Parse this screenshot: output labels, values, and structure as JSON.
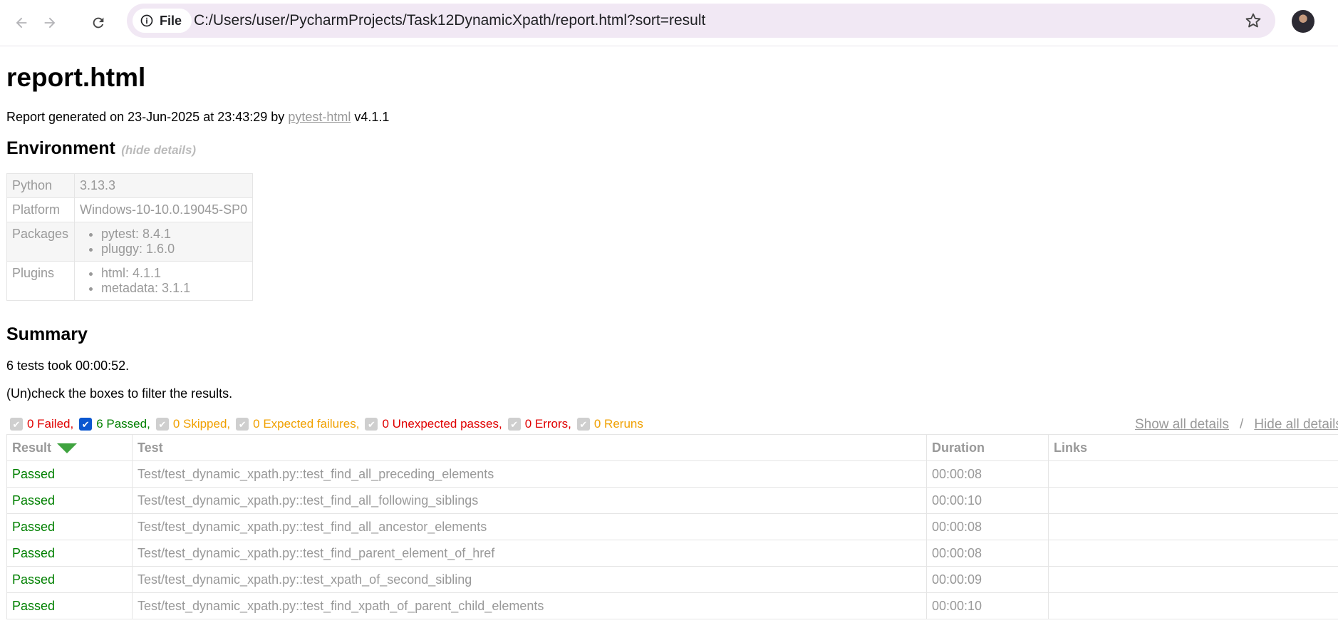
{
  "browser": {
    "site_info_label": "File",
    "url": "C:/Users/user/PycharmProjects/Task12DynamicXpath/report.html?sort=result"
  },
  "report": {
    "title": "report.html",
    "generated_prefix": "Report generated on 23-Jun-2025 at 23:43:29 by",
    "generator_link": "pytest-html",
    "generator_version": "v4.1.1"
  },
  "environment": {
    "heading": "Environment",
    "toggle": "(hide details)",
    "rows": [
      {
        "key": "Python",
        "value": "3.13.3"
      },
      {
        "key": "Platform",
        "value": "Windows-10-10.0.19045-SP0"
      },
      {
        "key": "Packages",
        "items": [
          "pytest: 8.4.1",
          "pluggy: 1.6.0"
        ]
      },
      {
        "key": "Plugins",
        "items": [
          "html: 4.1.1",
          "metadata: 3.1.1"
        ]
      }
    ]
  },
  "summary": {
    "heading": "Summary",
    "took": "6 tests took 00:00:52.",
    "filter_hint": "(Un)check the boxes to filter the results.",
    "filters": [
      {
        "label": "0 Failed,",
        "color": "#e00000",
        "checked": true,
        "disabled": true
      },
      {
        "label": "6 Passed,",
        "color": "#008000",
        "checked": true,
        "disabled": false
      },
      {
        "label": "0 Skipped,",
        "color": "#f0a000",
        "checked": true,
        "disabled": true
      },
      {
        "label": "0 Expected failures,",
        "color": "#f0a000",
        "checked": true,
        "disabled": true
      },
      {
        "label": "0 Unexpected passes,",
        "color": "#e00000",
        "checked": true,
        "disabled": true
      },
      {
        "label": "0 Errors,",
        "color": "#e00000",
        "checked": true,
        "disabled": true
      },
      {
        "label": "0 Reruns",
        "color": "#f0a000",
        "checked": true,
        "disabled": true
      }
    ],
    "show_all": "Show all details",
    "separator": "/",
    "hide_all": "Hide all details"
  },
  "results": {
    "columns": [
      "Result",
      "Test",
      "Duration",
      "Links"
    ],
    "sorted_by": "Result",
    "rows": [
      {
        "result": "Passed",
        "test": "Test/test_dynamic_xpath.py::test_find_all_preceding_elements",
        "duration": "00:00:08",
        "links": ""
      },
      {
        "result": "Passed",
        "test": "Test/test_dynamic_xpath.py::test_find_all_following_siblings",
        "duration": "00:00:10",
        "links": ""
      },
      {
        "result": "Passed",
        "test": "Test/test_dynamic_xpath.py::test_find_all_ancestor_elements",
        "duration": "00:00:08",
        "links": ""
      },
      {
        "result": "Passed",
        "test": "Test/test_dynamic_xpath.py::test_find_parent_element_of_href",
        "duration": "00:00:08",
        "links": ""
      },
      {
        "result": "Passed",
        "test": "Test/test_dynamic_xpath.py::test_xpath_of_second_sibling",
        "duration": "00:00:09",
        "links": ""
      },
      {
        "result": "Passed",
        "test": "Test/test_dynamic_xpath.py::test_find_xpath_of_parent_child_elements",
        "duration": "00:00:10",
        "links": ""
      }
    ]
  }
}
